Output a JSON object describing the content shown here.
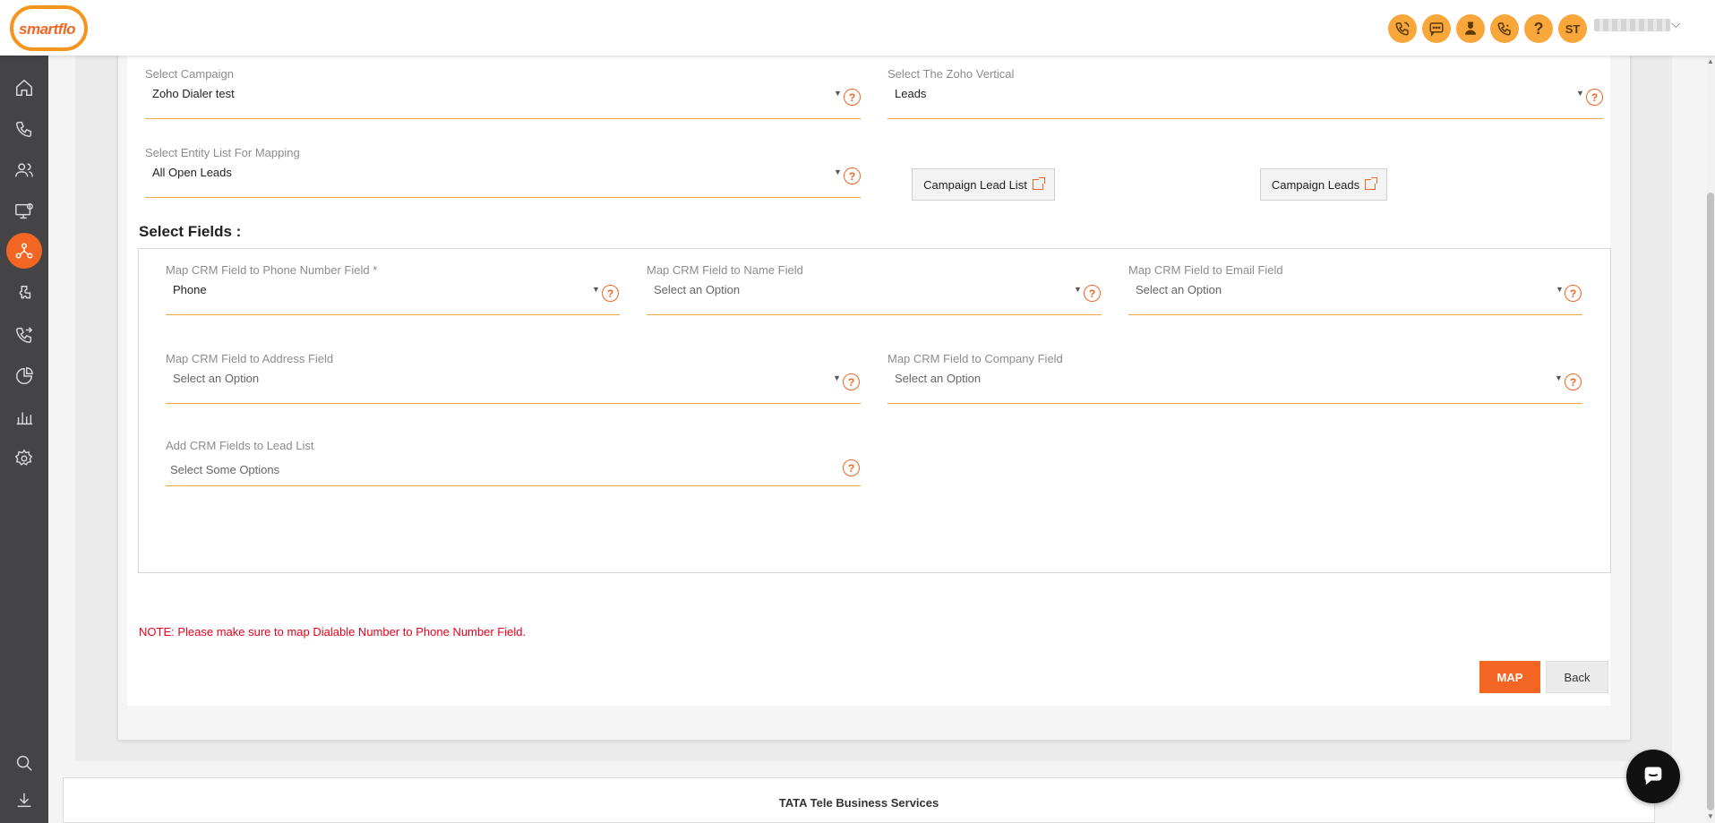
{
  "app": {
    "logo_text": "smartflo"
  },
  "topbar": {
    "icons": [
      "phone-ring-icon",
      "sms-icon",
      "agent-icon",
      "call-icon",
      "help-icon"
    ],
    "help_glyph": "?",
    "user_initials": "ST"
  },
  "sidebar": {
    "items": [
      "home-icon",
      "phone-icon",
      "users-icon",
      "monitor-settings-icon",
      "integrations-icon",
      "plugin-icon",
      "call-transfer-icon",
      "pie-chart-icon",
      "bar-chart-icon",
      "settings-icon",
      "search-icon",
      "download-icon"
    ],
    "active": "integrations-icon"
  },
  "form": {
    "campaign": {
      "label": "Select Campaign",
      "value": "Zoho Dialer test"
    },
    "vertical": {
      "label": "Select The Zoho Vertical",
      "value": "Leads"
    },
    "entity_list": {
      "label": "Select Entity List For Mapping",
      "value": "All Open Leads"
    },
    "campaign_lead_list_button": "Campaign Lead List",
    "campaign_leads_button": "Campaign Leads",
    "help_glyph": "?"
  },
  "select_fields": {
    "title": "Select Fields :",
    "phone": {
      "label": "Map CRM Field to Phone Number Field *",
      "value": "Phone"
    },
    "name": {
      "label": "Map CRM Field to Name Field",
      "placeholder": "Select an Option"
    },
    "email": {
      "label": "Map CRM Field to Email Field",
      "placeholder": "Select an Option"
    },
    "address": {
      "label": "Map CRM Field to Address Field",
      "placeholder": "Select an Option"
    },
    "company": {
      "label": "Map CRM Field to Company Field",
      "placeholder": "Select an Option"
    },
    "lead_list": {
      "label": "Add CRM Fields to Lead List",
      "placeholder": "Select Some Options"
    }
  },
  "note": "NOTE: Please make sure to map Dialable Number to Phone Number Field.",
  "actions": {
    "map": "MAP",
    "back": "Back"
  },
  "footer": {
    "text": "TATA Tele Business Services"
  },
  "colors": {
    "accent": "#f26522",
    "underline": "#f2a541",
    "note": "#e8001c",
    "sidebar": "#444446",
    "icon_bg": "#f9a63a"
  }
}
